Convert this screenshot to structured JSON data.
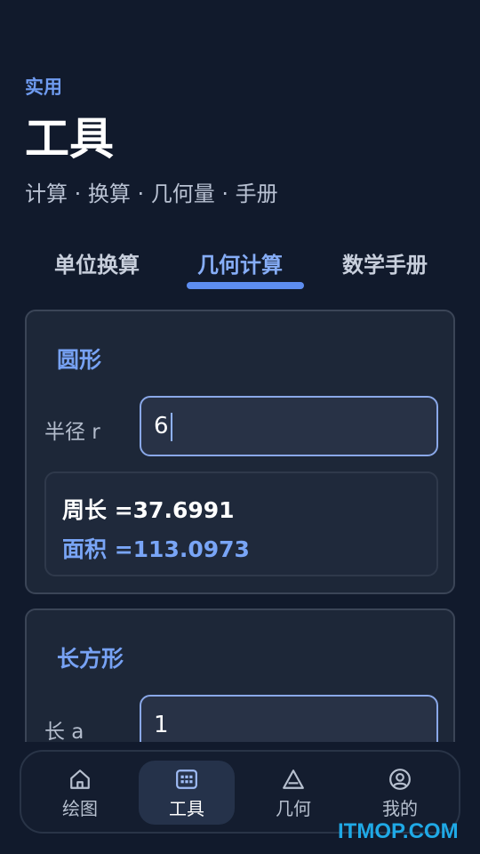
{
  "header": {
    "kicker": "实用",
    "title": "工具",
    "subtitle": "计算 · 换算 · 几何量 · 手册"
  },
  "tabs": [
    {
      "label": "单位换算",
      "active": false
    },
    {
      "label": "几何计算",
      "active": true
    },
    {
      "label": "数学手册",
      "active": false
    }
  ],
  "circle_card": {
    "title": "圆形",
    "radius_label": "半径 r",
    "radius_value": "6",
    "perimeter": "周长 =37.6991",
    "area": "面积 =113.0973"
  },
  "rect_card": {
    "title": "长方形",
    "length_label": "长 a",
    "length_value": "1"
  },
  "bottom_nav": [
    {
      "label": "绘图",
      "icon": "home-icon",
      "active": false
    },
    {
      "label": "工具",
      "icon": "calculator-icon",
      "active": true
    },
    {
      "label": "几何",
      "icon": "triangle-icon",
      "active": false
    },
    {
      "label": "我的",
      "icon": "user-icon",
      "active": false
    }
  ],
  "watermark": "ITMOP.COM",
  "colors": {
    "background": "#111a2c",
    "accent": "#5d8df0",
    "card": "#1d2738",
    "watermark": "#1fa9e6"
  }
}
